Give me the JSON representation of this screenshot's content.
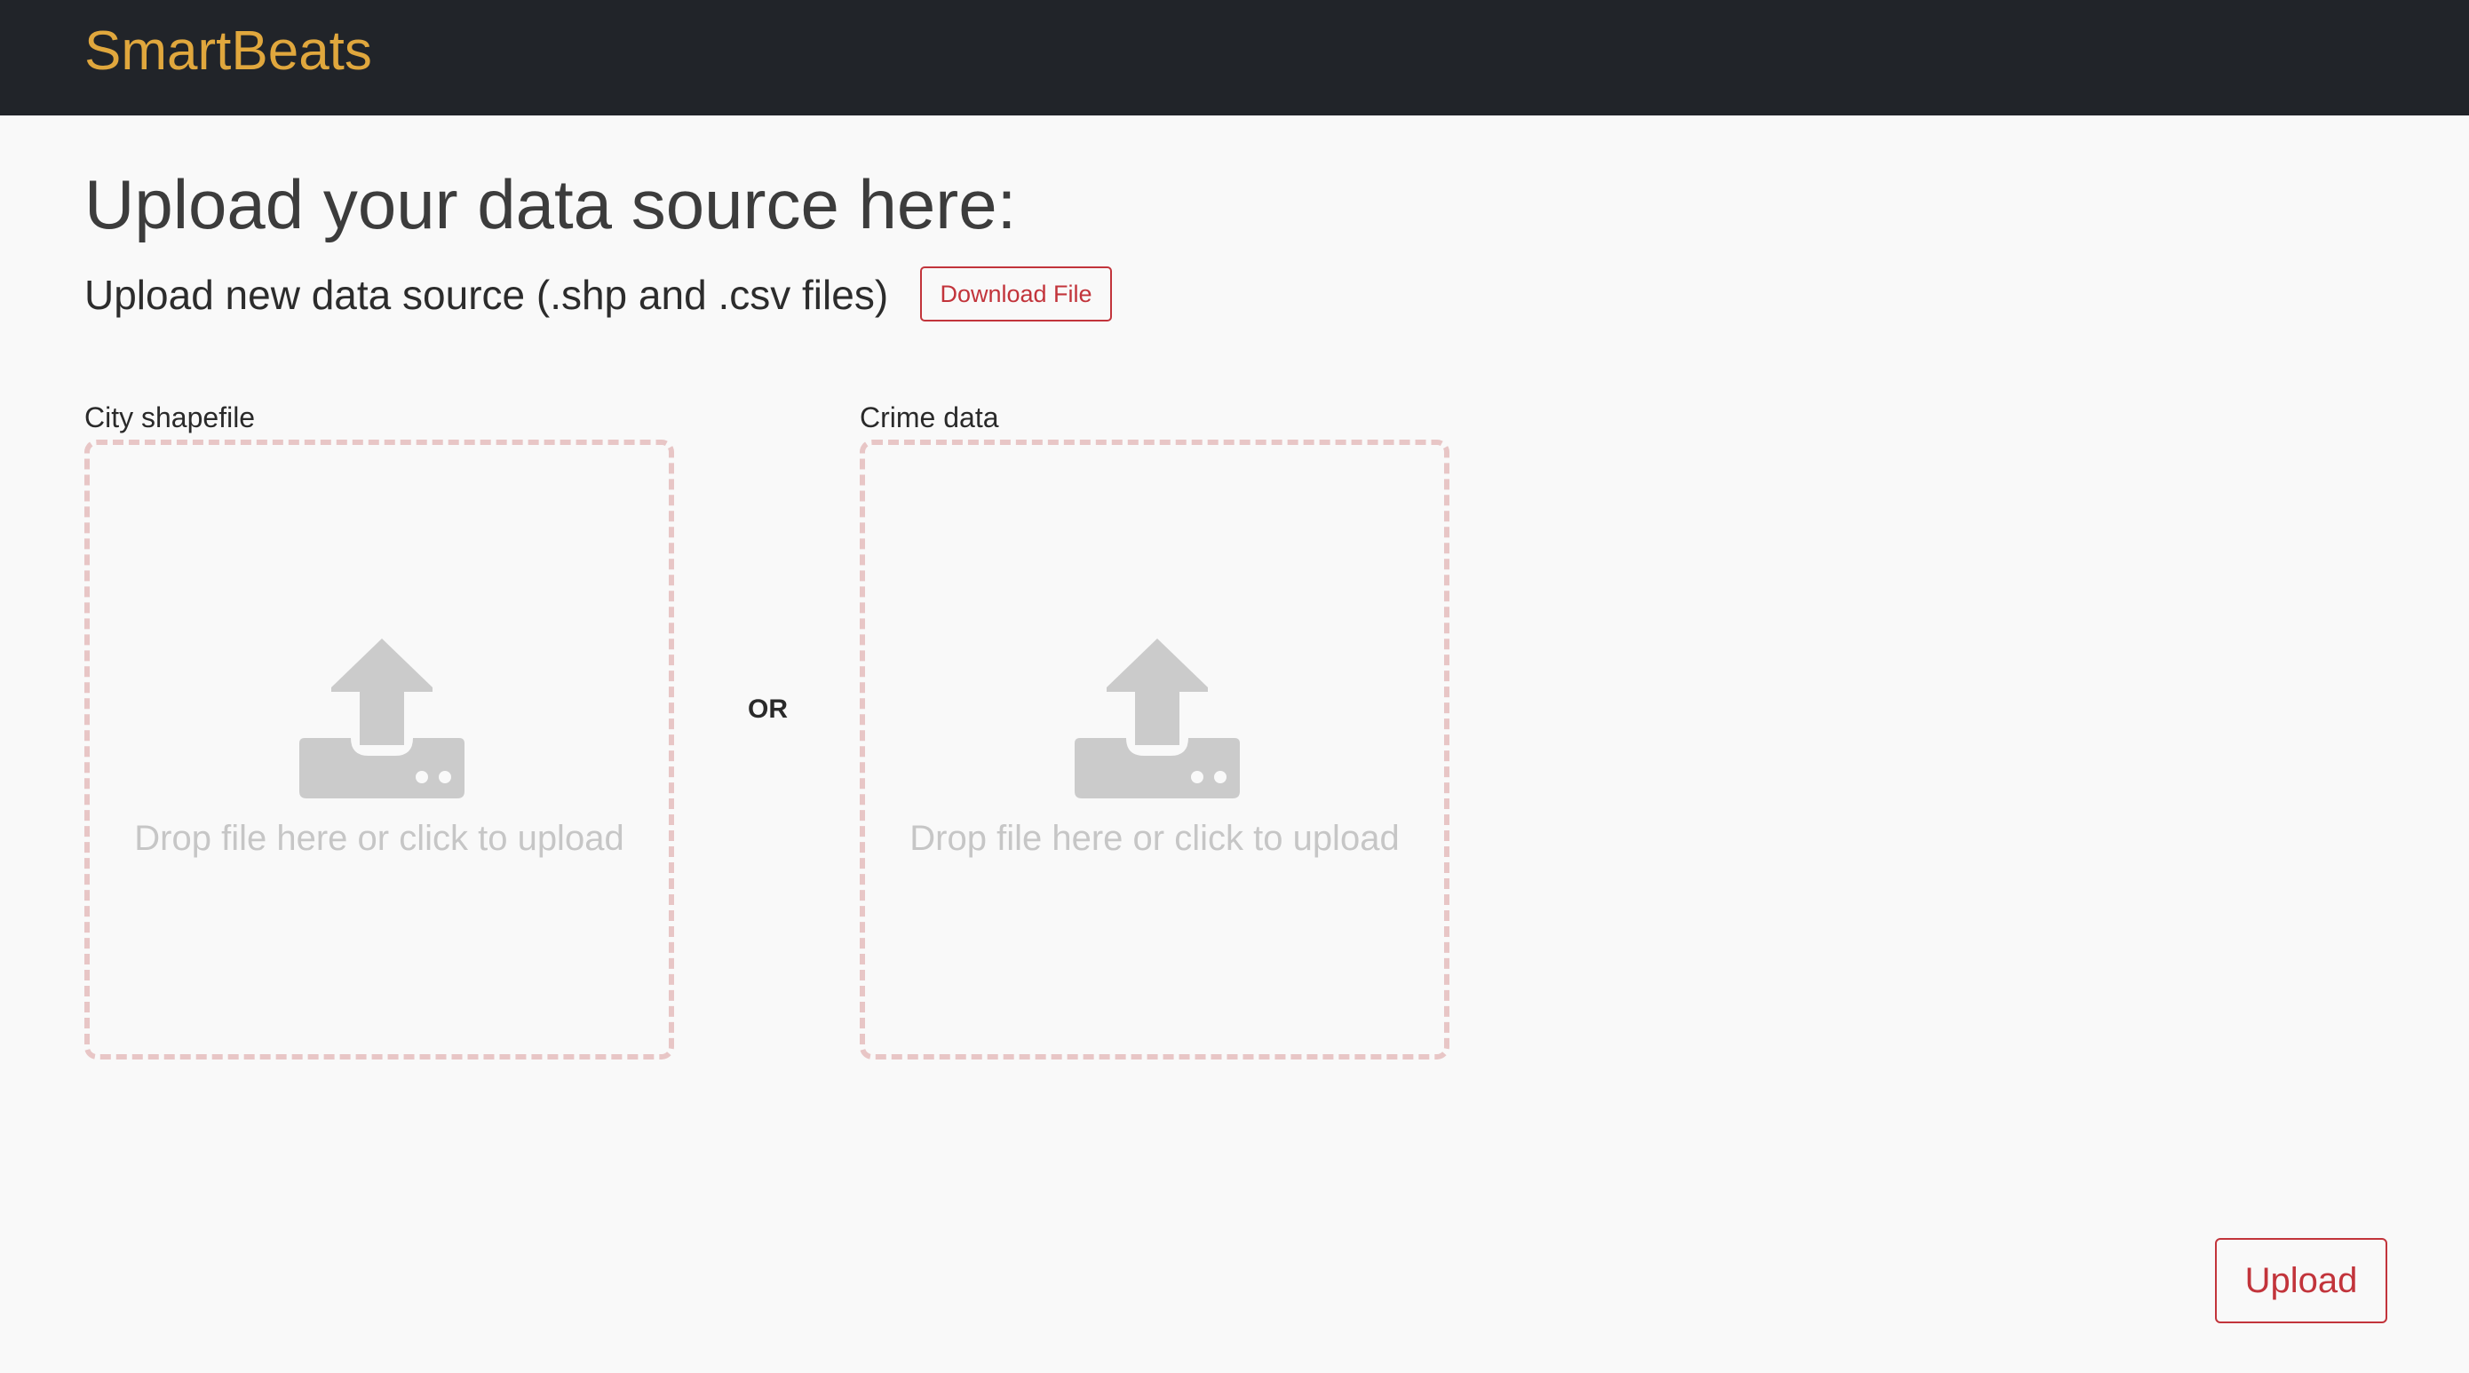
{
  "navbar": {
    "brand": "SmartBeats",
    "background": "#212429",
    "brand_color": "#e0a73d"
  },
  "page": {
    "title": "Upload your data source here:",
    "subtitle": "Upload new data source (.shp and .csv files)",
    "download_button": "Download File"
  },
  "uploads": {
    "city": {
      "label": "City shapefile",
      "prompt": "Drop file here or click to upload",
      "icon": "upload-tray-icon"
    },
    "separator": "OR",
    "crime": {
      "label": "Crime data",
      "prompt": "Drop file here or click to upload",
      "icon": "upload-tray-icon"
    }
  },
  "footer": {
    "upload_button": "Upload"
  },
  "colors": {
    "accent": "#c2343b",
    "dropzone_border": "#e8c6c6",
    "icon": "#cbcbcb"
  }
}
